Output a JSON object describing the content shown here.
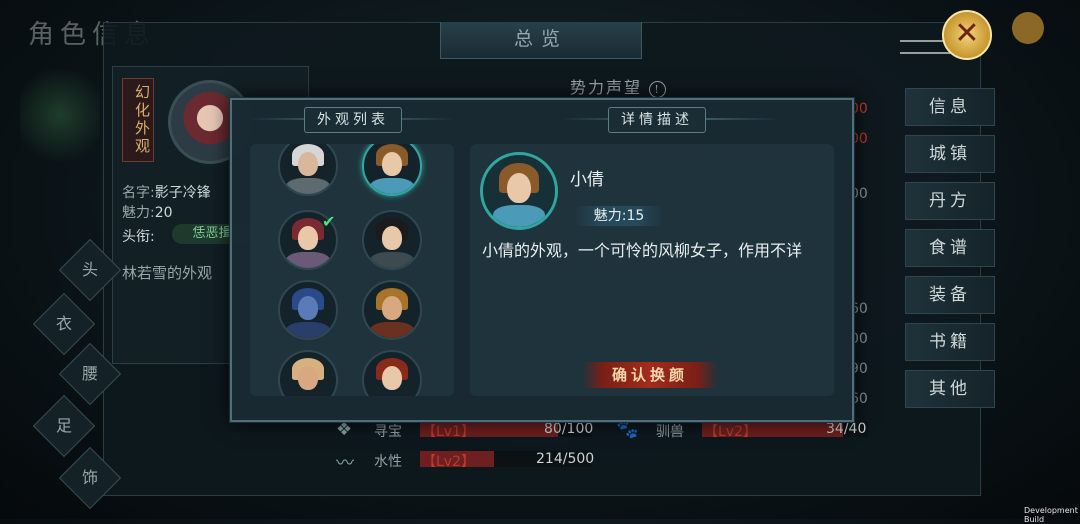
{
  "background": {
    "title": "角色信息",
    "header": "总览",
    "left_card": {
      "tag": "幻化外观",
      "name_label": "名字:",
      "name_value": "影子冷锋",
      "charm_label": "魅力:",
      "charm_value": "20",
      "title_label": "头衔:",
      "title_value": "恁恶揖",
      "appearance_text": "林若雪的外观"
    },
    "equip_slots": [
      "头",
      "衣",
      "腰",
      "足",
      "饰"
    ],
    "right_tabs": [
      "信息",
      "城镇",
      "丹方",
      "食谱",
      "装备",
      "书籍",
      "其他"
    ],
    "shili_label": "势力声望",
    "right_numbers": {
      "r1": "00",
      "r2": "00",
      "g1": "00",
      "g2": "60",
      "g3": "00",
      "g4": "90",
      "g5": "60"
    },
    "stats": [
      {
        "icon": "treasure-icon",
        "name": "寻宝",
        "lv": "【Lv1】",
        "value": "80/100",
        "fill": 0.8
      },
      {
        "icon": "paw-icon",
        "name": "驯兽",
        "lv": "【Lv2】",
        "value": "34/40",
        "fill": 0.85
      },
      {
        "icon": "water-icon",
        "name": "水性",
        "lv": "【Lv2】",
        "value": "214/500",
        "fill": 0.43
      }
    ]
  },
  "modal": {
    "list_title": "外观列表",
    "detail_title": "详情描述",
    "selected": {
      "name": "小倩",
      "charm_label": "魅力:",
      "charm_value": "15",
      "description": "小倩的外观，一个可怜的风柳女子，作用不详"
    },
    "confirm_label": "确认换颜"
  },
  "close_label": "✕",
  "dev_build": "Development Build",
  "colors": {
    "accent": "#2fa6a0",
    "confirm": "#a32b1d",
    "gold": "#c8952e",
    "level": "#c0392b"
  }
}
